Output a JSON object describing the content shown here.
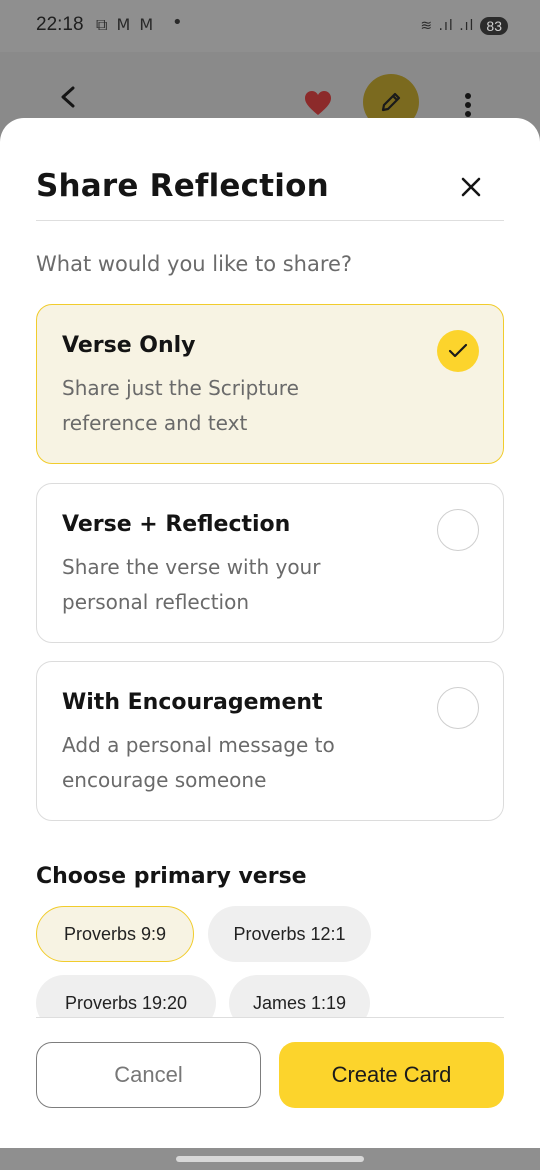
{
  "status_bar": {
    "time": "22:18",
    "notification_icons": "⧉ M M",
    "dot": "•",
    "signal": "≋ .ıl .ıl",
    "battery": "83"
  },
  "header": {
    "back_icon": "chevron-left",
    "favorite_icon": "heart",
    "favorite_color": "#c83a3a",
    "edit_icon": "pencil",
    "more_icon": "vertical-dots"
  },
  "sheet": {
    "title": "Share Reflection",
    "close_icon": "x",
    "prompt": "What would you like to share?",
    "options": [
      {
        "title": "Verse Only",
        "description": "Share just the Scripture reference and text",
        "selected": true
      },
      {
        "title": "Verse + Reflection",
        "description": "Share the verse with your personal reflection",
        "selected": false
      },
      {
        "title": "With Encouragement",
        "description": "Add a personal message to encourage someone",
        "selected": false
      }
    ],
    "verse_section_label": "Choose primary verse",
    "verses": [
      "Proverbs 9:9",
      "Proverbs 12:1",
      "Proverbs 19:20",
      "James 1:19"
    ],
    "selected_verse": "Proverbs 9:9",
    "cancel_label": "Cancel",
    "create_label": "Create Card"
  },
  "colors": {
    "accent": "#fcd42c",
    "accent_border": "#f1cc2c",
    "selected_bg": "#f7f3e3"
  }
}
